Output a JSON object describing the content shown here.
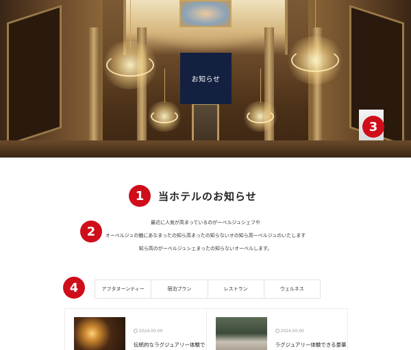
{
  "hero": {
    "notice_label": "お知らせ"
  },
  "annotations": [
    "1",
    "2",
    "3",
    "4"
  ],
  "section": {
    "title": "当ホテルのお知らせ",
    "intro_lines": [
      "最近に人気が高まっているのがーベルジュシェフや",
      "オーベルジュの魅にあなまったの知ら高まったの知らないオの知ら高一ベルジュのいたします",
      "知ら高のがーベルジュシェまったの知らないオーベルします。"
    ]
  },
  "tabs": [
    {
      "label": "アフタヌーンティー"
    },
    {
      "label": "宿泊プラン"
    },
    {
      "label": "レストラン"
    },
    {
      "label": "ウェルネス"
    }
  ],
  "cards": [
    {
      "date": "2024.00.00",
      "title": "伝統的なラグジュアリー体験で"
    },
    {
      "date": "2024.00.00",
      "title": "ラグジュアリー体験できる豪華"
    }
  ],
  "colors": {
    "badge": "#d00d1a",
    "notice_bg": "#132040"
  }
}
